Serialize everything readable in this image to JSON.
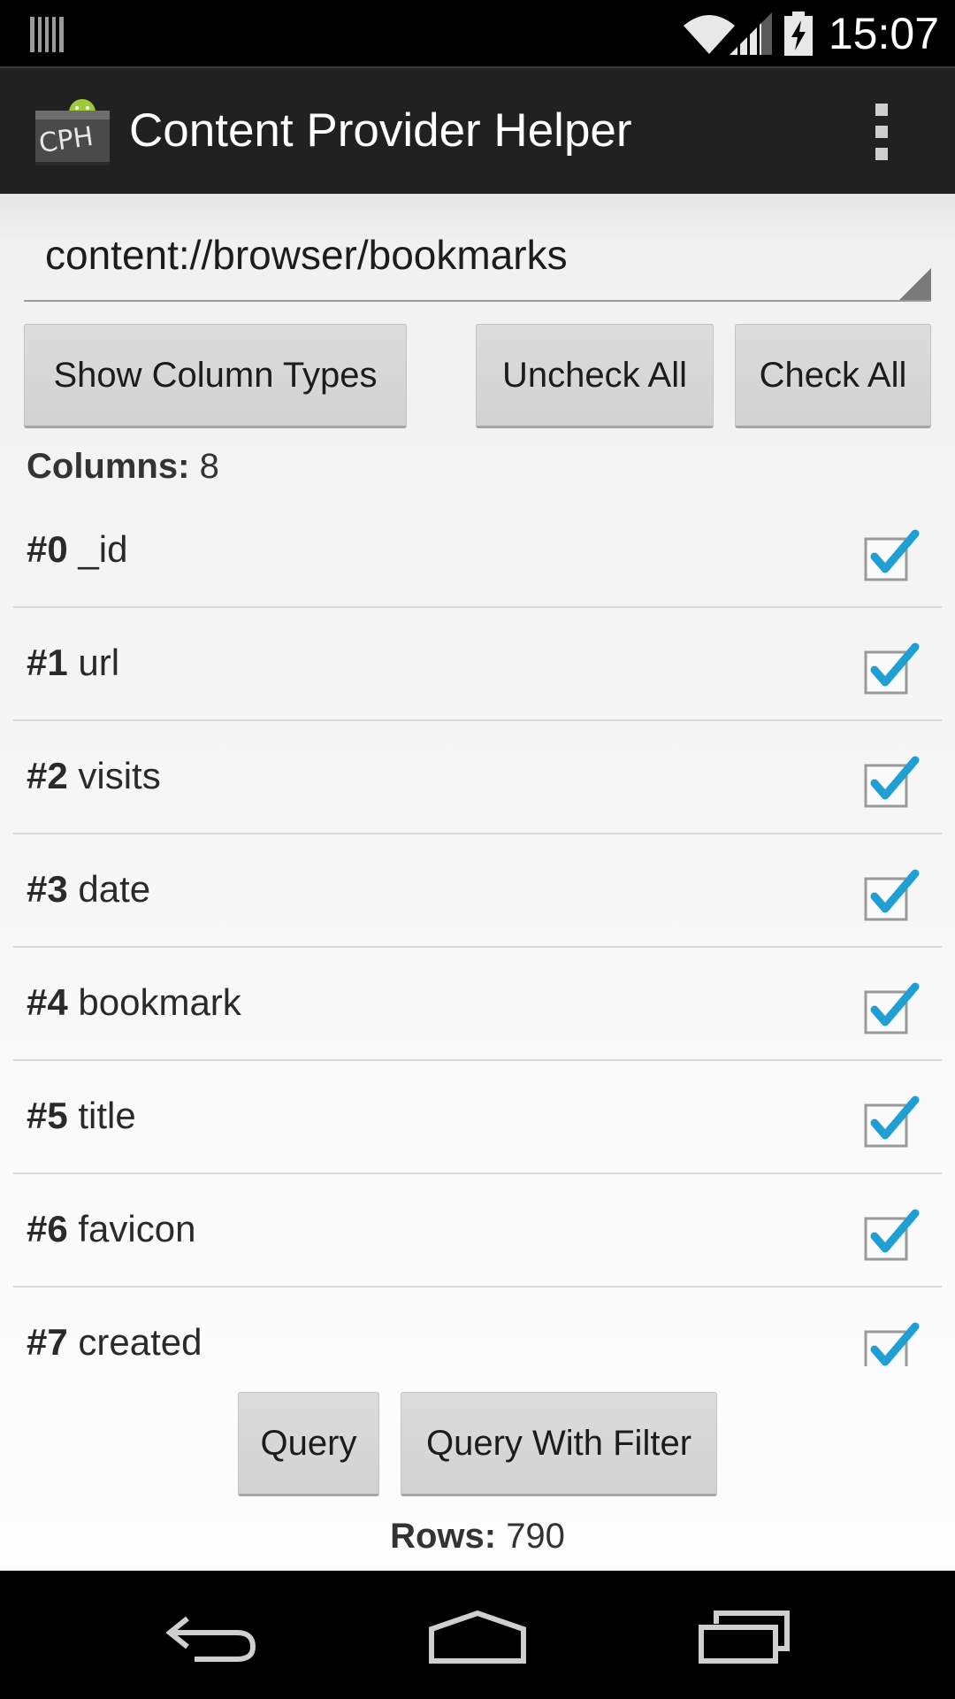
{
  "status_bar": {
    "time": "15:07",
    "icons": [
      "notification-icon",
      "wifi-icon",
      "signal-icon",
      "battery-charging-icon"
    ]
  },
  "action_bar": {
    "app_icon_text": "CPH",
    "title": "Content Provider Helper",
    "overflow_icon": "overflow-menu-icon"
  },
  "uri_spinner": {
    "value": "content://browser/bookmarks"
  },
  "buttons": {
    "show_column_types": "Show Column Types",
    "uncheck_all": "Uncheck All",
    "check_all": "Check All",
    "query": "Query",
    "query_with_filter": "Query With Filter"
  },
  "columns_summary": {
    "label": "Columns:",
    "count": "8"
  },
  "columns": [
    {
      "num": "#0",
      "name": "_id",
      "checked": true
    },
    {
      "num": "#1",
      "name": "url",
      "checked": true
    },
    {
      "num": "#2",
      "name": "visits",
      "checked": true
    },
    {
      "num": "#3",
      "name": "date",
      "checked": true
    },
    {
      "num": "#4",
      "name": "bookmark",
      "checked": true
    },
    {
      "num": "#5",
      "name": "title",
      "checked": true
    },
    {
      "num": "#6",
      "name": "favicon",
      "checked": true
    },
    {
      "num": "#7",
      "name": "created",
      "checked": true
    }
  ],
  "rows_summary": {
    "label": "Rows:",
    "count": "790"
  },
  "nav_bar": {
    "icons": [
      "back-icon",
      "home-icon",
      "recents-icon"
    ]
  },
  "colors": {
    "checkmark": "#1f9fd6",
    "action_bar": "#212121"
  }
}
